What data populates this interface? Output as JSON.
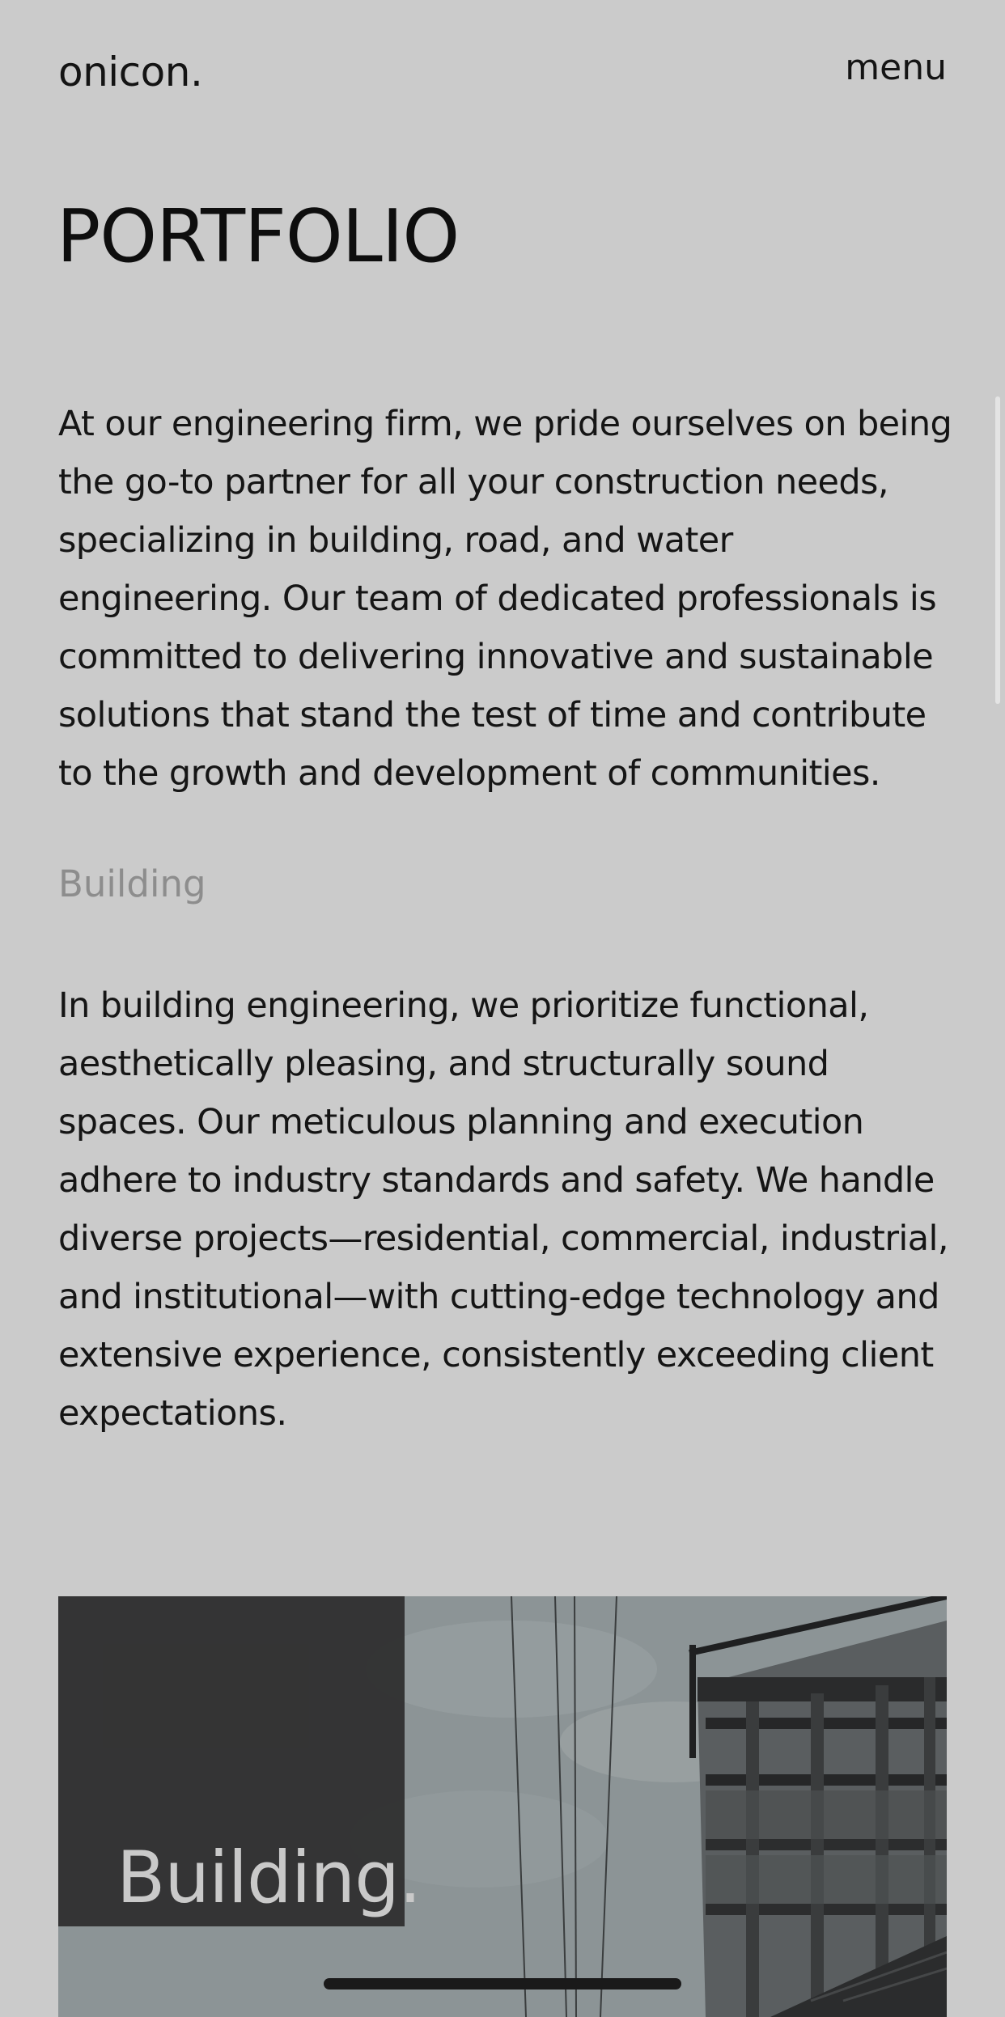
{
  "header": {
    "logo": "onicon.",
    "menu_label": "menu"
  },
  "page_title": "PORTFOLIO",
  "intro": "At our engineering firm, we pride ourselves on being the go-to partner for all your construction needs, specializing in building, road, and water engineering. Our team of dedicated professionals is committed to delivering innovative and sustainable solutions that stand the test of time and contribute to the growth and development of communities.",
  "section": {
    "label": "Building",
    "body": "In building engineering, we prioritize functional, aesthetically pleasing, and structurally sound spaces. Our meticulous planning and execution adhere to industry standards and safety. We handle diverse projects—residential, commercial, industrial, and institutional—with cutting-edge technology and extensive experience, consistently exceeding client expectations."
  },
  "hero": {
    "label": "Building."
  },
  "colors": {
    "background": "#cbcbcb",
    "text": "#151515",
    "muted": "#8d8d8d",
    "overlay": "#2d2d2d"
  }
}
